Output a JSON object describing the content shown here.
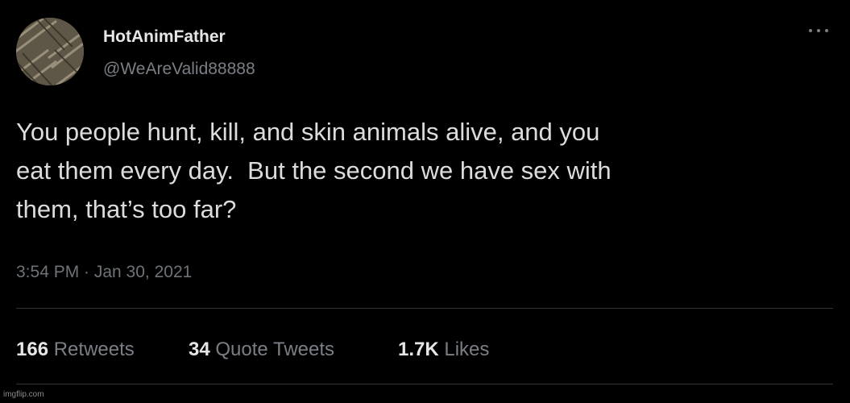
{
  "user": {
    "display_name": "HotAnimFather",
    "handle": "@WeAreValid88888"
  },
  "header": {
    "more_icon": "more-horizontal-icon"
  },
  "tweet": {
    "text": "You people hunt, kill, and skin animals alive, and you\neat them every day.  But the second we have sex with\nthem, that’s too far?",
    "timestamp": "3:54 PM · Jan 30, 2021"
  },
  "stats": {
    "retweets_count": "166",
    "retweets_label": "Retweets",
    "quotes_count": "34",
    "quotes_label": "Quote Tweets",
    "likes_count": "1.7K",
    "likes_label": "Likes"
  },
  "watermark": {
    "text": "imgflip.com"
  },
  "colors": {
    "background": "#000000",
    "primary_text": "#dcdcdc",
    "secondary_text": "#7a7f85",
    "divider": "#2f3336"
  }
}
